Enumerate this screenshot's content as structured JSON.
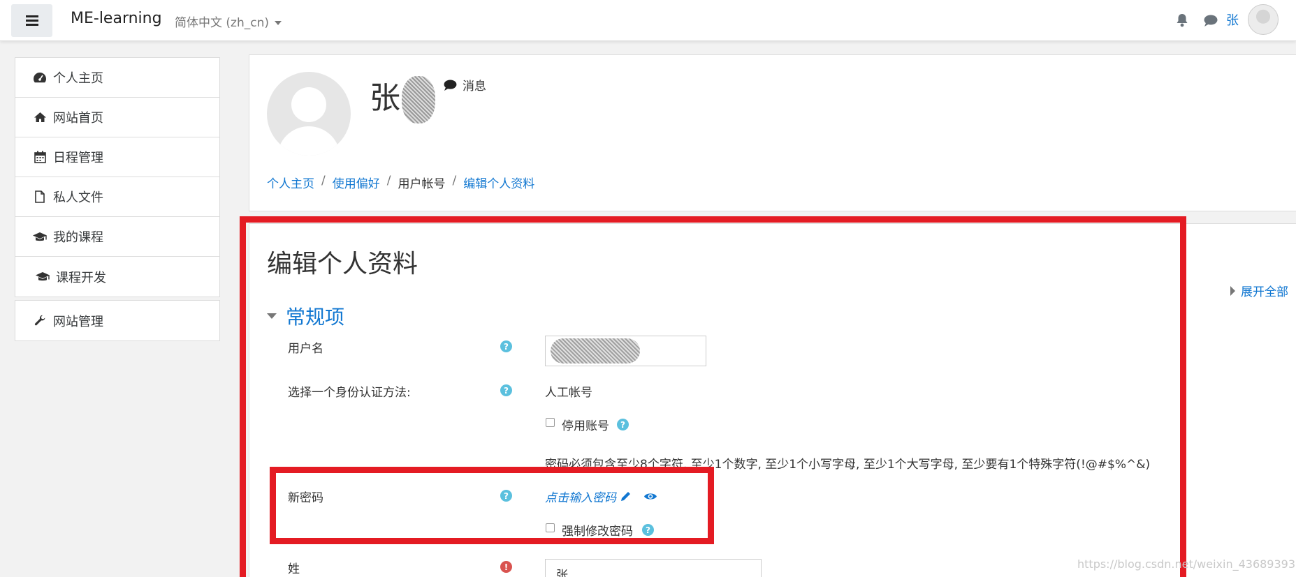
{
  "navbar": {
    "site_name": "ME-learning",
    "language": "简体中文 (zh_cn)",
    "user_label": "张"
  },
  "sidebar": {
    "items": [
      {
        "label": "个人主页",
        "icon": "dashboard-icon"
      },
      {
        "label": "网站首页",
        "icon": "home-icon"
      },
      {
        "label": "日程管理",
        "icon": "calendar-icon"
      },
      {
        "label": "私人文件",
        "icon": "file-icon"
      },
      {
        "label": "我的课程",
        "icon": "graduation-cap-icon"
      },
      {
        "label": "课程开发",
        "icon": "graduation-cap-icon"
      }
    ],
    "admin_item": {
      "label": "网站管理",
      "icon": "wrench-icon"
    }
  },
  "header": {
    "name_prefix": "张",
    "message_label": "消息",
    "breadcrumb": [
      {
        "label": "个人主页",
        "link": true
      },
      {
        "label": "使用偏好",
        "link": true
      },
      {
        "label": "用户帐号",
        "link": false
      },
      {
        "label": "编辑个人资料",
        "link": true
      }
    ]
  },
  "form": {
    "page_title": "编辑个人资料",
    "expand_all": "展开全部",
    "section_title": "常规项",
    "username_label": "用户名",
    "auth_label": "选择一个身份认证方法:",
    "auth_value": "人工帐号",
    "suspend_label": "停用账号",
    "password_policy": "密码必须包含至少8个字符, 至少1个数字, 至少1个小写字母, 至少1个大写字母, 至少要有1个特殊字符(!@#$%^&)",
    "new_password_label": "新密码",
    "new_password_link": "点击输入密码",
    "force_change_label": "强制修改密码",
    "lastname_label": "姓",
    "lastname_value": "张"
  },
  "colors": {
    "link": "#1177d1",
    "highlight_red": "#e41b23",
    "help_blue": "#5bc0de",
    "required_red": "#d9534f"
  },
  "watermark": "https://blog.csdn.net/weixin_43689393"
}
